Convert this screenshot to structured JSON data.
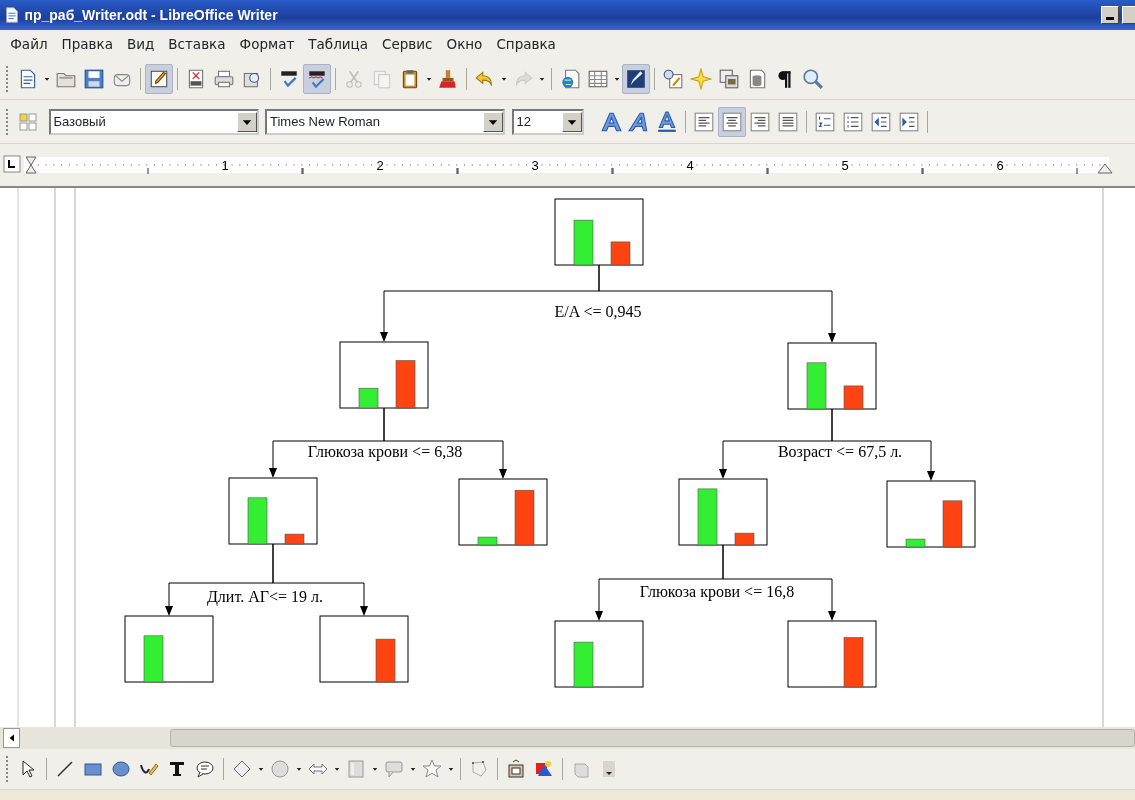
{
  "window": {
    "title": "пр_раб_Writer.odt - LibreOffice Writer"
  },
  "menu": [
    "Файл",
    "Правка",
    "Вид",
    "Вставка",
    "Формат",
    "Таблица",
    "Сервис",
    "Окно",
    "Справка"
  ],
  "standard_toolbar": [
    {
      "kind": "new",
      "on": false,
      "disabled": false
    },
    {
      "kind": "open",
      "on": false,
      "disabled": false
    },
    {
      "kind": "save",
      "on": false,
      "disabled": false
    },
    {
      "kind": "email",
      "on": false,
      "disabled": false
    },
    {
      "kind": "sep"
    },
    {
      "kind": "edit",
      "on": true,
      "disabled": false
    },
    {
      "kind": "sep"
    },
    {
      "kind": "pdf",
      "on": false,
      "disabled": false
    },
    {
      "kind": "print",
      "on": false,
      "disabled": false
    },
    {
      "kind": "preview",
      "on": false,
      "disabled": false
    },
    {
      "kind": "sep"
    },
    {
      "kind": "spell",
      "on": false,
      "disabled": false
    },
    {
      "kind": "autospell",
      "on": true,
      "disabled": false
    },
    {
      "kind": "sep"
    },
    {
      "kind": "cut",
      "on": false,
      "disabled": true
    },
    {
      "kind": "copy",
      "on": false,
      "disabled": true
    },
    {
      "kind": "paste",
      "on": false,
      "disabled": false
    },
    {
      "kind": "clone",
      "on": false,
      "disabled": false
    },
    {
      "kind": "sep"
    },
    {
      "kind": "undo",
      "on": false,
      "disabled": false
    },
    {
      "kind": "redo",
      "on": false,
      "disabled": true
    },
    {
      "kind": "sep"
    },
    {
      "kind": "hyperlink",
      "on": false,
      "disabled": false
    },
    {
      "kind": "table",
      "on": false,
      "disabled": false
    },
    {
      "kind": "draw",
      "on": true,
      "disabled": false
    },
    {
      "kind": "sep"
    },
    {
      "kind": "find",
      "on": false,
      "disabled": false
    },
    {
      "kind": "navigator",
      "on": false,
      "disabled": false
    },
    {
      "kind": "gallery",
      "on": false,
      "disabled": false
    },
    {
      "kind": "datasource",
      "on": false,
      "disabled": false
    },
    {
      "kind": "pilcrow",
      "on": false,
      "disabled": false
    },
    {
      "kind": "zoom",
      "on": false,
      "disabled": false
    }
  ],
  "format_toolbar": {
    "paragraph_style": "Базовый",
    "font_name": "Times New Roman",
    "font_size": "12",
    "text_style_buttons": [
      {
        "kind": "bold",
        "on": false
      },
      {
        "kind": "italic",
        "on": false
      },
      {
        "kind": "underline",
        "on": false
      }
    ],
    "align_buttons": [
      {
        "kind": "left",
        "selected": false
      },
      {
        "kind": "center",
        "selected": true
      },
      {
        "kind": "right",
        "selected": false
      },
      {
        "kind": "justify",
        "selected": false
      }
    ],
    "list_buttons": [
      {
        "kind": "numbered"
      },
      {
        "kind": "bulleted"
      },
      {
        "kind": "outdent"
      },
      {
        "kind": "indent"
      }
    ]
  },
  "ruler": {
    "labels": [
      "1",
      "2",
      "3",
      "4",
      "5",
      "6"
    ]
  },
  "tree": {
    "split": "E/A <= 0,945",
    "bars": [
      {
        "kind": "left",
        "color": "#33ee33"
      },
      {
        "kind": "right",
        "color": "#ff4411"
      }
    ],
    "children": [
      {
        "split": "Глюкоза крови <= 6,38",
        "bars": [
          {
            "kind": "left",
            "color": "#33ee33"
          },
          {
            "kind": "right",
            "color": "#ff4411"
          }
        ],
        "children": [
          {
            "split": "Длит. АГ<= 19 л.",
            "bars": [
              {
                "kind": "left",
                "color": "#33ee33"
              },
              {
                "kind": "right",
                "color": "#ff4411"
              }
            ],
            "children": [
              {
                "bars": [
                  {
                    "kind": "left",
                    "color": "#33ee33"
                  }
                ]
              },
              {
                "bars": [
                  {
                    "kind": "right",
                    "color": "#ff4411"
                  }
                ]
              }
            ]
          },
          {
            "bars": [
              {
                "kind": "left",
                "color": "#33ee33"
              },
              {
                "kind": "right",
                "color": "#ff4411"
              }
            ]
          }
        ]
      },
      {
        "split": "Возраст <= 67,5 л.",
        "bars": [
          {
            "kind": "left",
            "color": "#33ee33"
          },
          {
            "kind": "right",
            "color": "#ff4411"
          }
        ],
        "children": [
          {
            "split": "Глюкоза крови <= 16,8",
            "bars": [
              {
                "kind": "left",
                "color": "#33ee33"
              },
              {
                "kind": "right",
                "color": "#ff4411"
              }
            ],
            "children": [
              {
                "bars": [
                  {
                    "kind": "left",
                    "color": "#33ee33"
                  }
                ]
              },
              {
                "bars": [
                  {
                    "kind": "right",
                    "color": "#ff4411"
                  }
                ]
              }
            ]
          },
          {
            "bars": [
              {
                "kind": "left",
                "color": "#33ee33"
              },
              {
                "kind": "right",
                "color": "#ff4411"
              }
            ]
          }
        ]
      }
    ]
  },
  "drawing_toolbar": [
    {
      "kind": "select",
      "on": false
    },
    {
      "kind": "sep"
    },
    {
      "kind": "line",
      "on": false
    },
    {
      "kind": "rect",
      "on": false
    },
    {
      "kind": "ellipse",
      "on": false
    },
    {
      "kind": "freeform",
      "on": false
    },
    {
      "kind": "text",
      "on": false
    },
    {
      "kind": "callout",
      "on": false
    },
    {
      "kind": "sep"
    },
    {
      "kind": "basic",
      "on": false
    },
    {
      "kind": "symbol",
      "on": false
    },
    {
      "kind": "arrows",
      "on": false
    },
    {
      "kind": "flowchart",
      "on": false
    },
    {
      "kind": "callouts",
      "on": false
    },
    {
      "kind": "stars",
      "on": false
    },
    {
      "kind": "sep"
    },
    {
      "kind": "points",
      "on": false
    },
    {
      "kind": "sep"
    },
    {
      "kind": "fontwork",
      "on": false
    },
    {
      "kind": "insertimg",
      "on": false
    },
    {
      "kind": "sep"
    },
    {
      "kind": "extrusion",
      "on": false
    },
    {
      "kind": "more",
      "on": false
    }
  ]
}
